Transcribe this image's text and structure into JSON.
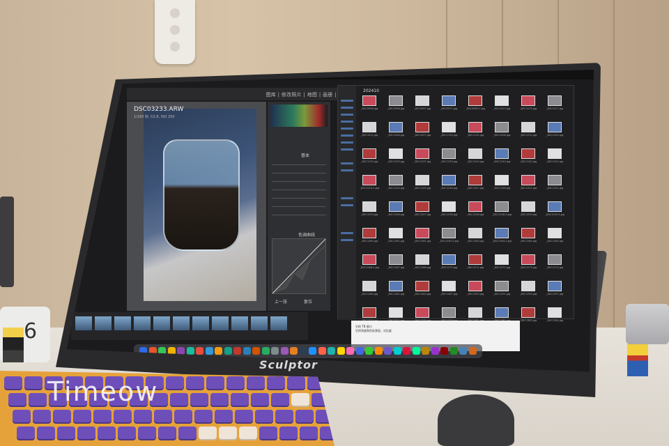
{
  "lightroom": {
    "modules": "图库 | 修改照片 | 地图 | 画册 | 幻灯片放映 | 打印 | Web",
    "photo_title": "DSC03233.ARW",
    "photo_sub": "1/160 秒, f/2.8, ISO 250",
    "panel_basic": "基本",
    "panel_curve": "色调曲线",
    "prev_button": "上一张",
    "reset_button": "复位"
  },
  "finder": {
    "title": "202410",
    "files": [
      "_DSC0996.jpg",
      "_DSC0998.jpg",
      "_DSC0997.jpg",
      "_DSC0977.jpg",
      "_DSC0983-2.jpg",
      "_DSC1013.jpg",
      "_DSC1015.jpg",
      "_DSC1017.jpg",
      "_DSC1012.jpg",
      "_DSC1026.jpg",
      "_DSC1027.jpg",
      "_DSC1130.jpg",
      "_DSC1112.jpg",
      "_DSC1208.jpg",
      "_DSC1212.jpg",
      "_DSC1220.jpg",
      "_DSC1232.jpg",
      "_DSC1235.jpg",
      "_DSC1237.jpg",
      "_DSC1239.jpg",
      "_DSC1240.jpg",
      "_DSC1240.jpg",
      "_DSC1242.jpg",
      "_DSC1243.jpg",
      "_DSC1244-2.jpg",
      "_DSC1244.jpg",
      "_DSC1245.jpg",
      "_DSC1246.jpg",
      "_DSC1247.jpg",
      "_DSC1248.jpg",
      "_DSC1251.jpg",
      "_DSC1252.jpg",
      "_DSC1253.jpg",
      "_DSC1256.jpg",
      "_DSC1257.jpg",
      "_DSC1258.jpg",
      "_DSC1258.jpg",
      "_DSC1258-2.jpg",
      "_DSC1259.jpg",
      "_DSC1259-2.jpg",
      "_DSC1260.jpg",
      "_DSC1261.jpg",
      "_DSC1262.jpg",
      "_DSC1263-2.jpg",
      "_DSC1263.jpg",
      "_DSC1264-2.jpg",
      "_DSC1264.jpg",
      "_DSC1265.jpg",
      "_DSC1266-2.jpg",
      "_DSC1267.jpg",
      "_DSC1268.jpg",
      "_DSC1270.jpg",
      "_DSC1271.jpg",
      "_DSC1272.jpg",
      "_DSC1273.jpg",
      "_DSC1274.jpg",
      "_DSC1280.jpg",
      "_DSC1281.jpg",
      "_DSC1283.jpg",
      "_DSC1287.jpg",
      "_DSC1290.jpg",
      "_DSC1291.jpg",
      "_DSC1295.jpg",
      "_DSC1297.jpg",
      "_DSC1370.jpg",
      "_DSC1372.jpg",
      "_DSC1375.jpg",
      "_DSC1379.jpg",
      "_DSC1381.jpg",
      "_DSC1382.jpg",
      "_DSC1383.jpg",
      "_DSC1384.jpg"
    ]
  },
  "document": {
    "line1": "它的 TB 接口",
    "line2": "它的亮度和色彩表现，对比度"
  },
  "hardware": {
    "brand": "Sculptor",
    "clock_digit": "6"
  },
  "watermark": "Timeow",
  "colors": {
    "lr_dark": "#2e2f32",
    "finder_bg": "#1f1f21",
    "keyboard_purple": "#6e4fb9",
    "keyboard_orange": "#e6a23a"
  }
}
